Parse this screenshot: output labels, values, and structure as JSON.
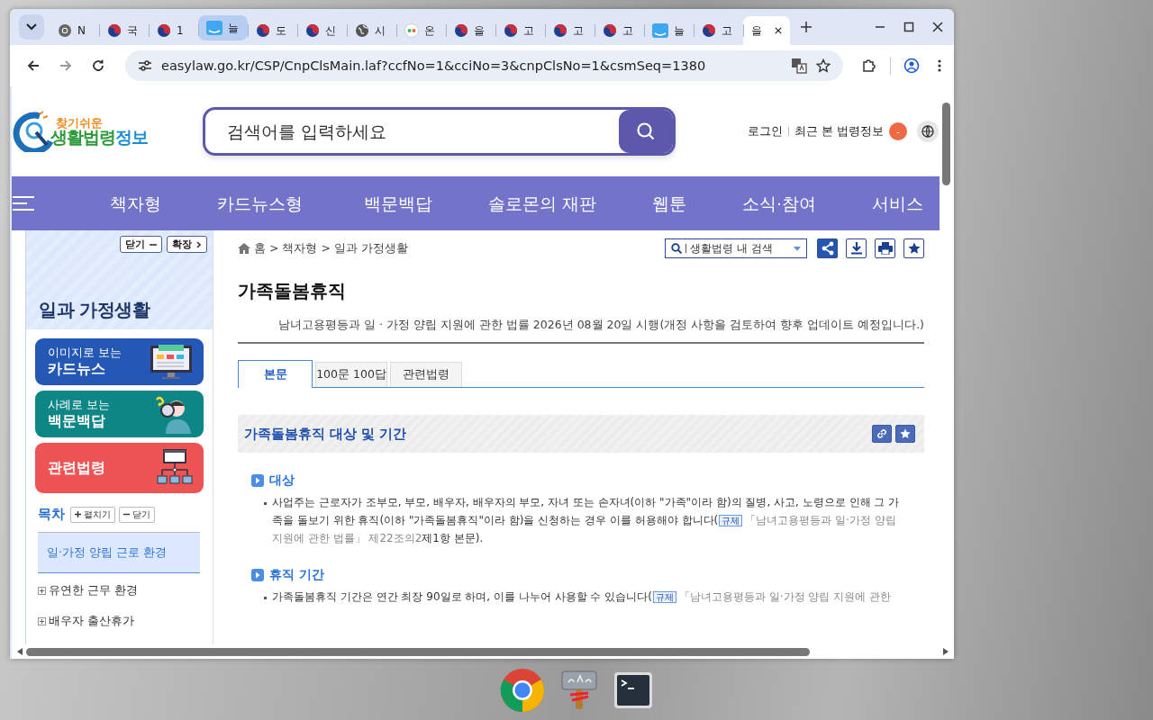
{
  "browser": {
    "tabs": [
      {
        "kind": "chrome",
        "title": "N",
        "selected": false,
        "hovered": false
      },
      {
        "kind": "emblem",
        "title": "국",
        "selected": false,
        "hovered": false
      },
      {
        "kind": "emblem",
        "title": "1",
        "selected": false,
        "hovered": false
      },
      {
        "kind": "easylaw",
        "title": "늘",
        "selected": false,
        "hovered": true
      },
      {
        "kind": "emblem",
        "title": "도",
        "selected": false,
        "hovered": false
      },
      {
        "kind": "emblem",
        "title": "신",
        "selected": false,
        "hovered": false
      },
      {
        "kind": "globe",
        "title": "시",
        "selected": false,
        "hovered": false
      },
      {
        "kind": "seal",
        "title": "온",
        "selected": false,
        "hovered": false
      },
      {
        "kind": "emblem",
        "title": "을",
        "selected": false,
        "hovered": false
      },
      {
        "kind": "emblem",
        "title": "고",
        "selected": false,
        "hovered": false
      },
      {
        "kind": "emblem",
        "title": "고",
        "selected": false,
        "hovered": false
      },
      {
        "kind": "emblem",
        "title": "고",
        "selected": false,
        "hovered": false
      },
      {
        "kind": "easylaw",
        "title": "늘",
        "selected": false,
        "hovered": false
      },
      {
        "kind": "emblem",
        "title": "고",
        "selected": false,
        "hovered": false
      },
      {
        "kind": "plain",
        "title": "을",
        "selected": true,
        "hovered": false
      }
    ],
    "url": "easylaw.go.kr/CSP/CnpClsMain.laf?ccfNo=1&cciNo=3&cnpClsNo=1&csmSeq=1380"
  },
  "site": {
    "logo_top": "찾기쉬운",
    "logo_main": "생활법령",
    "logo_tail": "정보",
    "search_placeholder": "검색어를 입력하세요",
    "login": "로그인",
    "recent": "최근 본 법령정보",
    "recent_count": "-",
    "nav": [
      "책자형",
      "카드뉴스형",
      "백문백답",
      "솔로몬의 재판",
      "웹툰",
      "소식·참여",
      "서비스"
    ]
  },
  "sidebar": {
    "close": "닫기",
    "expand": "확장",
    "title": "일과 가정생활",
    "cards": [
      {
        "kind": "cardnews",
        "sub": "이미지로 보는",
        "title": "카드뉴스"
      },
      {
        "kind": "qa",
        "sub": "사례로 보는",
        "title": "백문백답"
      },
      {
        "kind": "law",
        "title": "관련법령"
      }
    ],
    "toc": {
      "title": "목차",
      "expand": "펼치기",
      "collapse": "닫기",
      "items": [
        {
          "label": "일·가정 양립 근로 환경",
          "selected": true,
          "has_children": false
        },
        {
          "label": "유연한 근무 환경",
          "selected": false,
          "has_children": true
        },
        {
          "label": "배우자 출산휴가",
          "selected": false,
          "has_children": true
        }
      ]
    }
  },
  "main": {
    "breadcrumb": "홈 > 책자형 > 일과 가정생활",
    "site_search_placeholder": "생활법령 내 검색",
    "title": "가족돌봄휴직",
    "law_note": "남녀고용평등과 일 · 가정 양립 지원에 관한 법률 2026년 08월 20일 시행(개정 사항을 검토하여 향후 업데이트 예정입니다.)",
    "tabs": [
      {
        "label": "본문",
        "selected": true
      },
      {
        "label": "100문 100답",
        "selected": false
      },
      {
        "label": "관련법령",
        "selected": false
      }
    ],
    "section_title": "가족돌봄휴직 대상 및 기간",
    "subsections": [
      {
        "heading": "대상",
        "paragraphs": [
          {
            "text": "사업주는 근로자가 조부모, 부모, 배우자, 배우자의 부모, 자녀 또는 손자녀(이하 \"가족\"이라 함)의 질병, 사고, 노령으로 인해 그 가족을 돌보기 위한 휴직(이하 \"가족돌봄휴직\"이라 함)을 신청하는 경우 이를 허용해야 합니다(",
            "tag": "규제",
            "link": "「남녀고용평등과 일·가정 양립 지원에 관한 법률」 제22조의2",
            "tail": "제1항 본문)."
          }
        ]
      },
      {
        "heading": "휴직 기간",
        "paragraphs": [
          {
            "text": "가족돌봄휴직 기간은 연간 최장 90일로 하며, 이를 나누어 사용할 수 있습니다(",
            "tag": "규제",
            "link": "「남녀고용평등과 일·가정 양립 지원에 관한"
          }
        ]
      }
    ]
  }
}
